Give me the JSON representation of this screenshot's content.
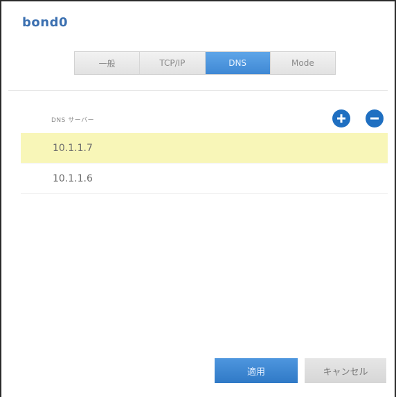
{
  "window": {
    "title": "bond0"
  },
  "tabs": [
    {
      "label": "一般",
      "active": false
    },
    {
      "label": "TCP/IP",
      "active": false
    },
    {
      "label": "DNS",
      "active": true
    },
    {
      "label": "Mode",
      "active": false
    }
  ],
  "dns": {
    "section_label": "DNS サーバー",
    "add_icon": "plus-circle-icon",
    "remove_icon": "minus-circle-icon",
    "servers": [
      {
        "address": "10.1.1.7",
        "selected": true
      },
      {
        "address": "10.1.1.6",
        "selected": false
      }
    ]
  },
  "footer": {
    "apply_label": "適用",
    "cancel_label": "キャンセル"
  },
  "colors": {
    "accent": "#3f88d4",
    "selected_row": "#f8f6b8",
    "title": "#3a6fb0"
  }
}
